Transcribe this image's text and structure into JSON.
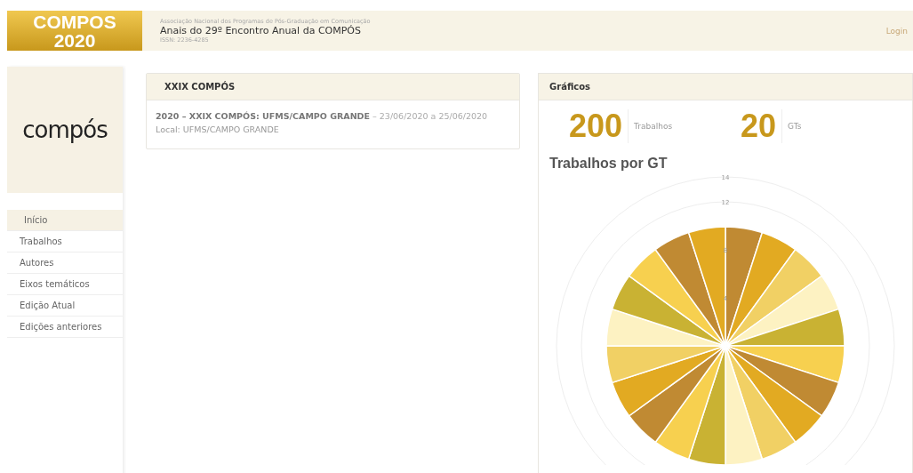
{
  "brand": {
    "title": "COMPOS",
    "year": "2020"
  },
  "header": {
    "subtitle": "Associação Nacional dos Programas de Pós-Graduação em Comunicação",
    "title": "Anais do 29º Encontro Anual da COMPÓS",
    "issn": "ISSN: 2236-4285",
    "login": "Login"
  },
  "sidebar": {
    "logo": "compós",
    "items": [
      {
        "label": "Início",
        "selected": true
      },
      {
        "label": "Trabalhos",
        "selected": false
      },
      {
        "label": "Autores",
        "selected": false
      },
      {
        "label": "Eixos temáticos",
        "selected": false
      },
      {
        "label": "Edição Atual",
        "selected": false
      },
      {
        "label": "Edições anteriores",
        "selected": false
      }
    ]
  },
  "event_card": {
    "title": "XXIX COMPÓS",
    "event": "2020 – XXIX COMPÓS: UFMS/CAMPO GRANDE",
    "dates": " – 23/06/2020 a 25/06/2020",
    "location": "Local: UFMS/CAMPO GRANDE"
  },
  "charts_card": {
    "title": "Gráficos",
    "stats": [
      {
        "value": "200",
        "label": "Trabalhos"
      },
      {
        "value": "20",
        "label": "GTs"
      }
    ],
    "chart_title": "Trabalhos por GT",
    "polar_chart": {
      "ring_labels": [
        "14",
        "12",
        "8",
        "4"
      ]
    }
  }
}
